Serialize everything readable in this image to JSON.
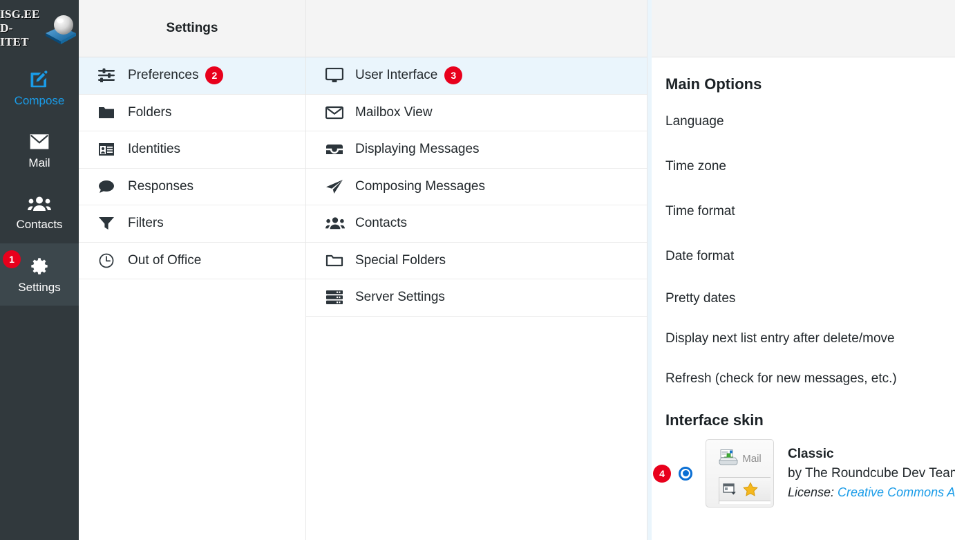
{
  "rail": {
    "logo": {
      "line1": "ISG.EE",
      "line2": "D-ITET",
      "mark_icon": "isg-sphere-logo-icon"
    },
    "items": [
      {
        "label": "Compose",
        "icon": "compose-pencil-icon",
        "active": false
      },
      {
        "label": "Mail",
        "icon": "envelope-icon",
        "active": false
      },
      {
        "label": "Contacts",
        "icon": "contacts-group-icon",
        "active": false
      },
      {
        "label": "Settings",
        "icon": "gear-icon",
        "active": true,
        "badge": "1"
      }
    ]
  },
  "settings_column": {
    "header": "Settings",
    "items": [
      {
        "label": "Preferences",
        "icon": "sliders-icon",
        "selected": true,
        "badge": "2"
      },
      {
        "label": "Folders",
        "icon": "folder-filled-icon",
        "selected": false
      },
      {
        "label": "Identities",
        "icon": "identity-card-icon",
        "selected": false
      },
      {
        "label": "Responses",
        "icon": "speech-bubble-icon",
        "selected": false
      },
      {
        "label": "Filters",
        "icon": "funnel-icon",
        "selected": false
      },
      {
        "label": "Out of Office",
        "icon": "clock-icon",
        "selected": false
      }
    ]
  },
  "preferences_column": {
    "header": "",
    "items": [
      {
        "label": "User Interface",
        "icon": "monitor-icon",
        "selected": true,
        "badge": "3"
      },
      {
        "label": "Mailbox View",
        "icon": "envelope-outline-icon",
        "selected": false
      },
      {
        "label": "Displaying Messages",
        "icon": "inbox-tray-icon",
        "selected": false
      },
      {
        "label": "Composing Messages",
        "icon": "paper-plane-icon",
        "selected": false
      },
      {
        "label": "Contacts",
        "icon": "contacts-group-icon",
        "selected": false
      },
      {
        "label": "Special Folders",
        "icon": "folder-outline-icon",
        "selected": false
      },
      {
        "label": "Server Settings",
        "icon": "server-stack-icon",
        "selected": false
      }
    ]
  },
  "main_pane": {
    "main_options": {
      "title": "Main Options",
      "rows": [
        {
          "label": "Language"
        },
        {
          "label": "Time zone"
        },
        {
          "label": "Time format"
        },
        {
          "label": "Date format"
        },
        {
          "label": "Pretty dates"
        },
        {
          "label": "Display next list entry after delete/move"
        },
        {
          "label": "Refresh (check for new messages, etc.)"
        }
      ]
    },
    "interface_skin": {
      "title": "Interface skin",
      "badge": "4",
      "selected": true,
      "thumbnail": {
        "mail_label": "Mail",
        "icons": [
          "inbox-download-icon",
          "window-dropdown-icon",
          "star-icon"
        ]
      },
      "name": "Classic",
      "author": "by The Roundcube Dev Team",
      "license_prefix": "License: ",
      "license_link": "Creative Commons At"
    }
  },
  "colors": {
    "rail_bg": "#31393d",
    "rail_active_bg": "#3c474c",
    "accent_blue": "#1a9ce8",
    "badge_red": "#e8001c",
    "selected_row": "#eaf5fc",
    "header_bg": "#f4f4f4",
    "radio_blue": "#0a6fd4"
  }
}
